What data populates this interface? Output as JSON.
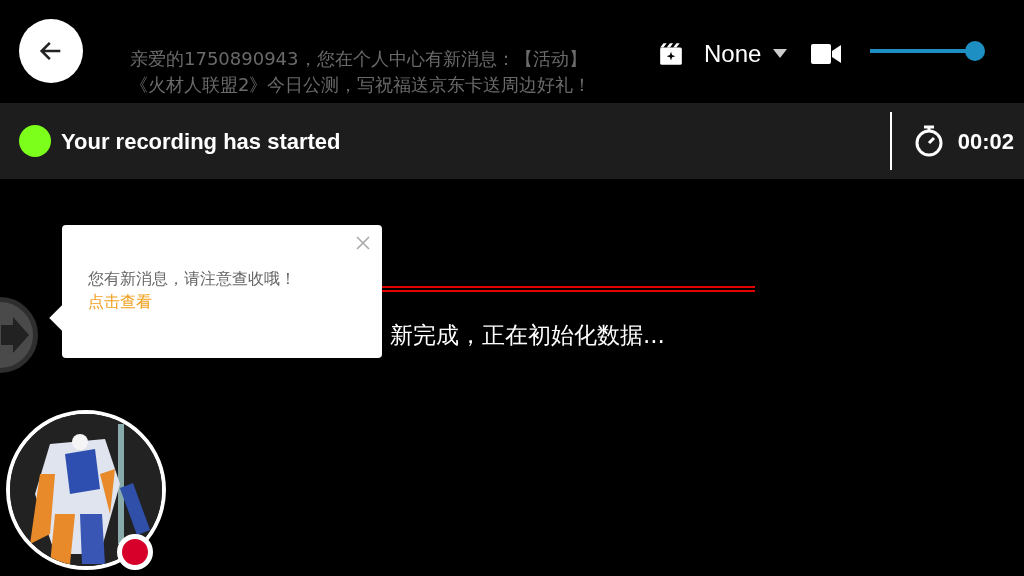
{
  "top_bar": {
    "filter": {
      "label": "None"
    },
    "volume": {
      "level": 0.95
    }
  },
  "background_notice": {
    "lines": [
      "亲爱的1750890943，您在个人中心有新消息：【活动】",
      "《火材人联盟2》今日公测，写祝福送京东卡送周边好礼！"
    ]
  },
  "recording_bar": {
    "status": "Your recording has started",
    "timer": "00:02"
  },
  "loading_text": "新完成，正在初始化数据...",
  "message_popup": {
    "text": "您有新消息，请注意查收哦！",
    "link": "点击查看"
  },
  "camera_preview": {
    "kind": "picture",
    "recording": true
  }
}
